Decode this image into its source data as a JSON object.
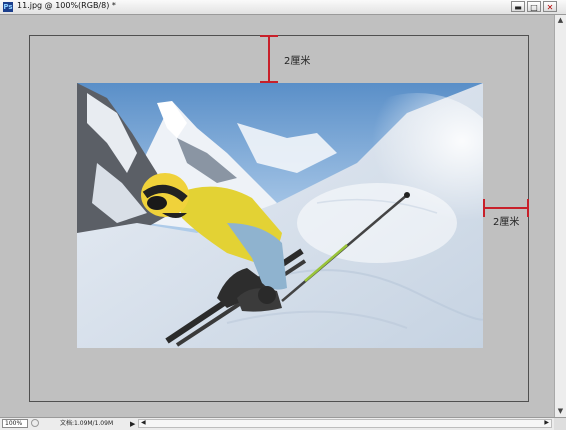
{
  "window": {
    "title": "11.jpg @ 100%(RGB/8) *",
    "app_icon": "Ps",
    "min_glyph": "▬",
    "max_glyph": "□",
    "close_glyph": "✕"
  },
  "annotations": {
    "top_margin_label": "2厘米",
    "right_margin_label": "2厘米",
    "accent_color": "#c8202a"
  },
  "statusbar": {
    "zoom": "100%",
    "doc_info": "文档:1.09M/1.09M",
    "menu_arrow": "▶",
    "scroll_left": "◀",
    "scroll_right": "▶"
  },
  "scroll": {
    "up": "▲",
    "down": "▼"
  },
  "icons": [
    "photoshop-app-icon",
    "minimize-icon",
    "maximize-icon",
    "close-icon",
    "status-icon",
    "arrow-right-icon"
  ]
}
